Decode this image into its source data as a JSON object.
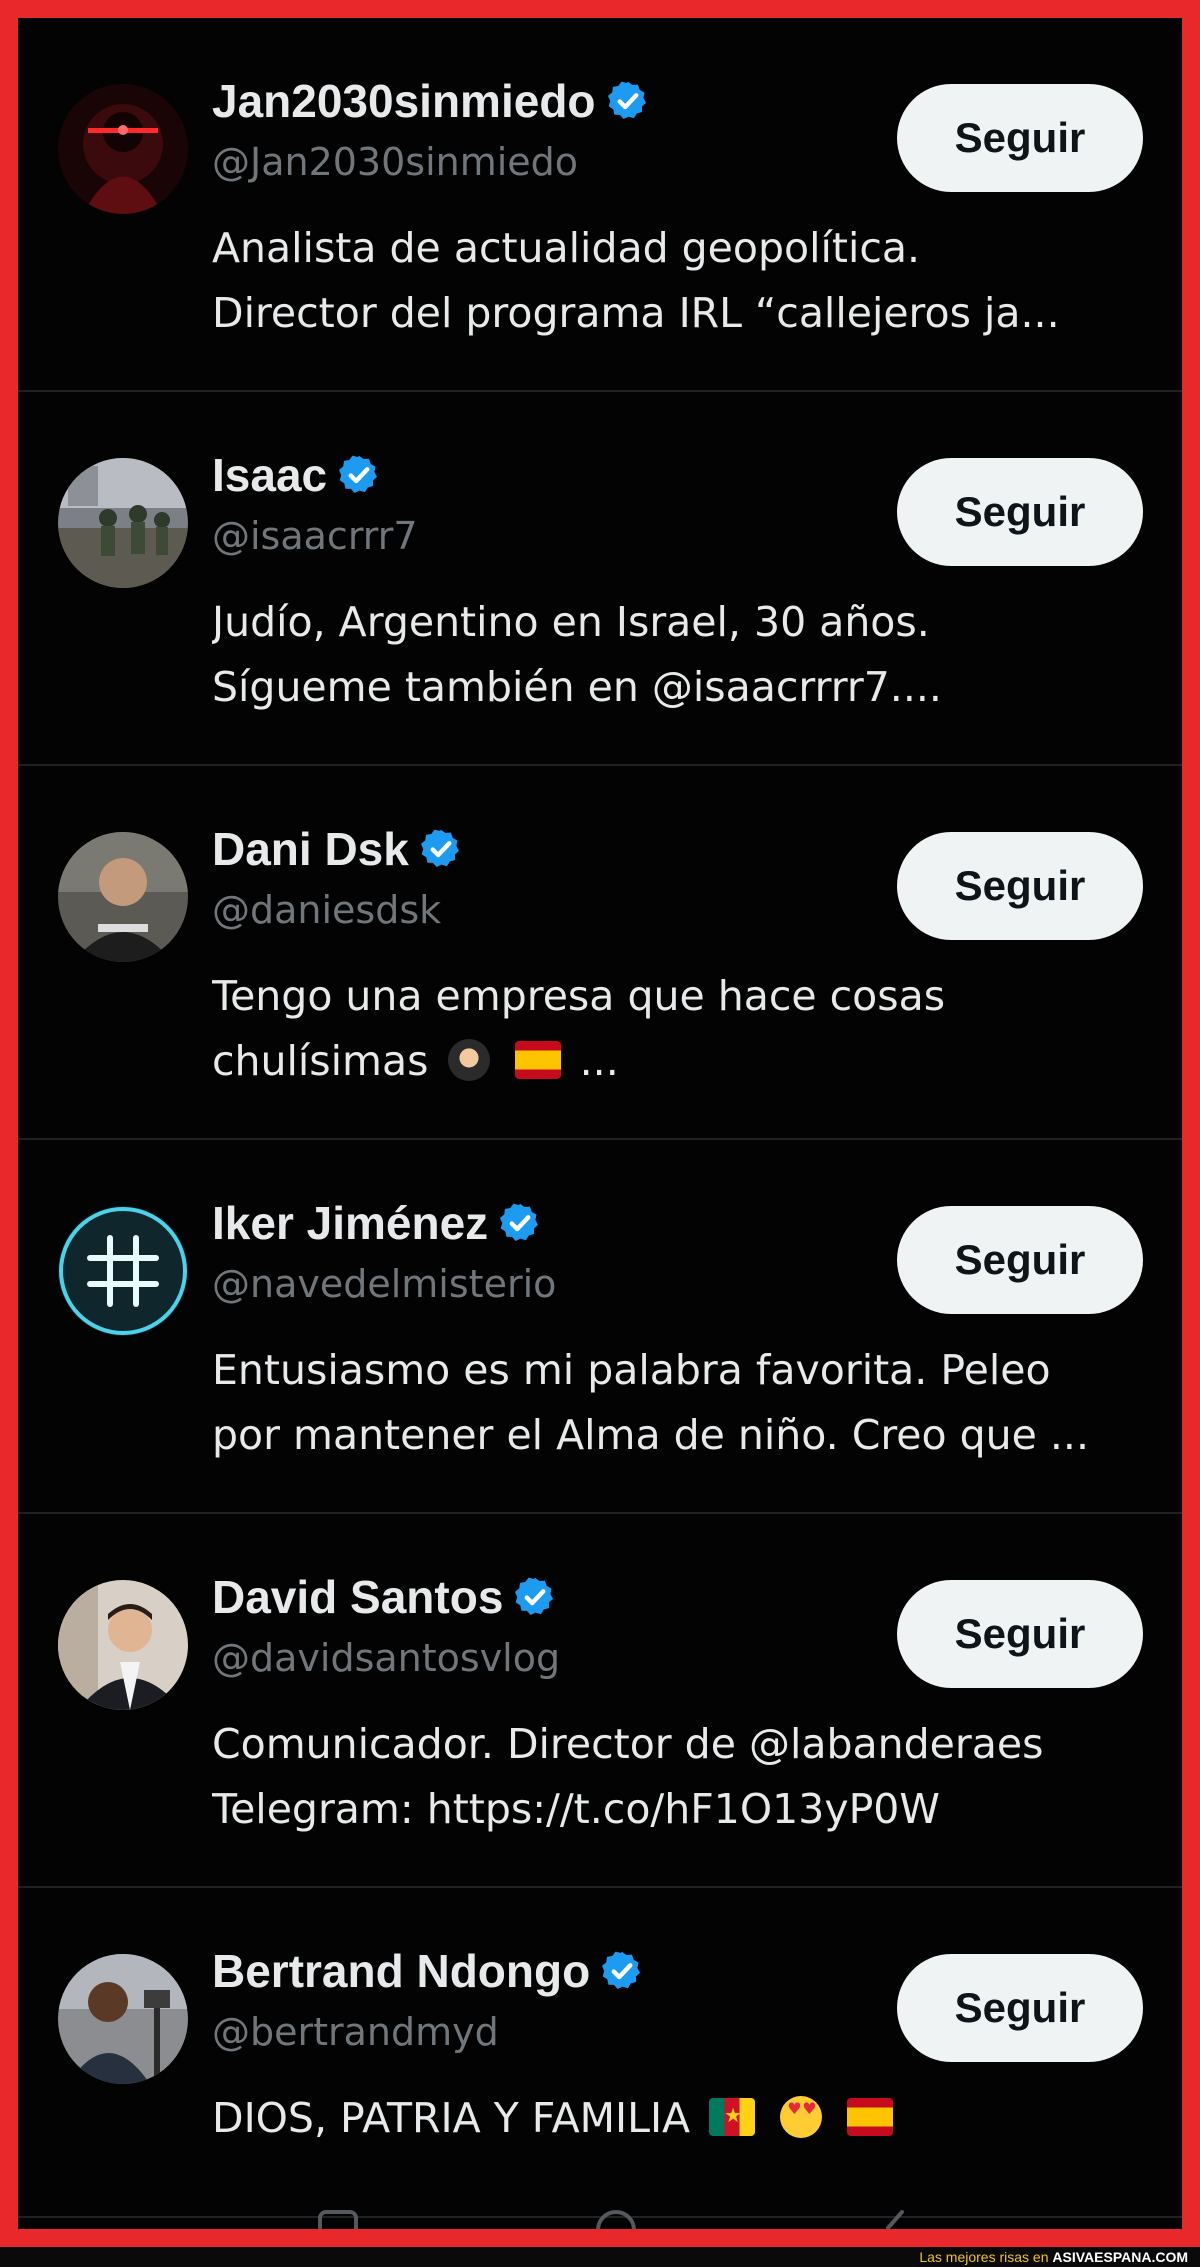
{
  "accounts": [
    {
      "name": "Jan2030sinmiedo",
      "handle": "@Jan2030sinmiedo",
      "bio_lines": [
        "Analista de actualidad geopolítica.",
        "Director del programa IRL “callejeros ja..."
      ],
      "follow_label": "Seguir"
    },
    {
      "name": "Isaac",
      "handle": "@isaacrrr7",
      "bio_lines": [
        "Judío, Argentino en Israel, 30 años.",
        "Sígueme también en @isaacrrrr7...."
      ],
      "follow_label": "Seguir"
    },
    {
      "name": "Dani Dsk",
      "handle": "@daniesdsk",
      "bio_lines": [
        "Tengo una empresa que hace cosas",
        "chulísimas",
        "..."
      ],
      "follow_label": "Seguir"
    },
    {
      "name": "Iker Jiménez",
      "handle": "@navedelmisterio",
      "bio_lines": [
        "Entusiasmo es mi palabra favorita. Peleo",
        "por mantener el Alma de niño. Creo que ..."
      ],
      "follow_label": "Seguir"
    },
    {
      "name": "David Santos",
      "handle": "@davidsantosvlog",
      "bio_lines": [
        "Comunicador. Director de @labanderaes",
        "Telegram: https://t.co/hF1O13yP0W"
      ],
      "follow_label": "Seguir"
    },
    {
      "name": "Bertrand Ndongo",
      "handle": "@bertrandmyd",
      "bio_lines": [
        "DIOS, PATRIA Y FAMILIA"
      ],
      "follow_label": "Seguir"
    }
  ],
  "icons": {
    "verified": "verified-badge-icon",
    "emoji_dani": [
      "ninja-emoji-icon",
      "spain-flag-icon"
    ],
    "emoji_bertrand": [
      "cameroon-flag-icon",
      "heart-eyes-emoji-icon",
      "spain-flag-icon"
    ]
  },
  "footer": {
    "prefix": "Las mejores risas en ",
    "site": "ASIVAESPANA.COM"
  },
  "colors": {
    "background": "#030303",
    "frame": "#e8282b",
    "name": "#e7e9ea",
    "handle": "#71767b",
    "verified": "#1d9bf0",
    "follow_button": "#eff3f4",
    "divider": "#1f2124"
  }
}
